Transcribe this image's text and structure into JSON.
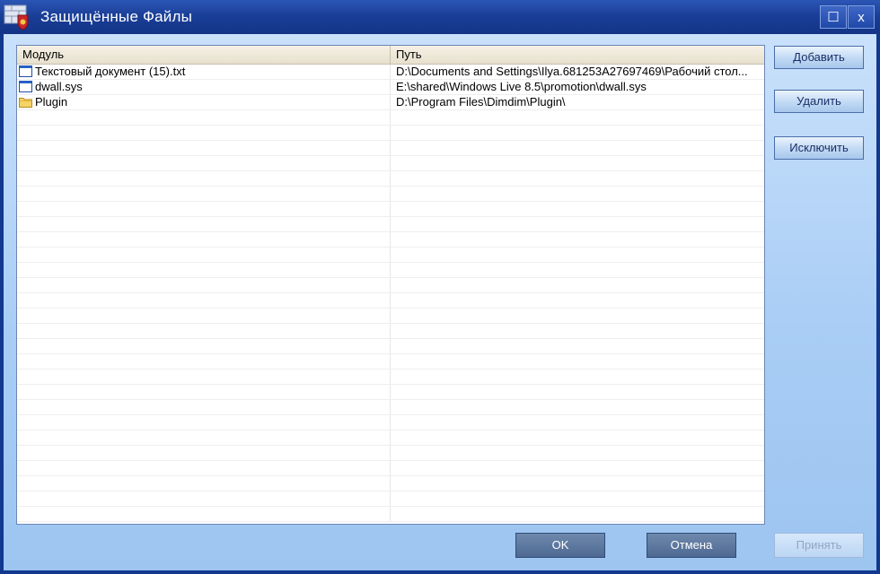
{
  "window": {
    "title": "Защищённые Файлы",
    "maximize_glyph": "☐",
    "close_glyph": "x"
  },
  "table": {
    "columns": [
      "Модуль",
      "Путь"
    ],
    "rows": [
      {
        "module": "Текстовый документ (15).txt",
        "path": "D:\\Documents and Settings\\Ilya.681253A27697469\\Рабочий стол...",
        "icon": "text-file-icon"
      },
      {
        "module": "dwall.sys",
        "path": "E:\\shared\\Windows Live 8.5\\promotion\\dwall.sys",
        "icon": "system-file-icon"
      },
      {
        "module": "Plugin",
        "path": "D:\\Program Files\\Dimdim\\Plugin\\",
        "icon": "folder-icon"
      }
    ]
  },
  "side_buttons": {
    "add": "Добавить",
    "remove": "Удалить",
    "exclude": "Исключить"
  },
  "bottom_buttons": {
    "ok": "OK",
    "cancel": "Отмена",
    "apply": "Принять"
  },
  "colors": {
    "titlebar": "#1a3f98",
    "client_bg": "#b5d5f7",
    "ok_button": "#5d779f",
    "apply_disabled_text": "#8ea6c8"
  }
}
